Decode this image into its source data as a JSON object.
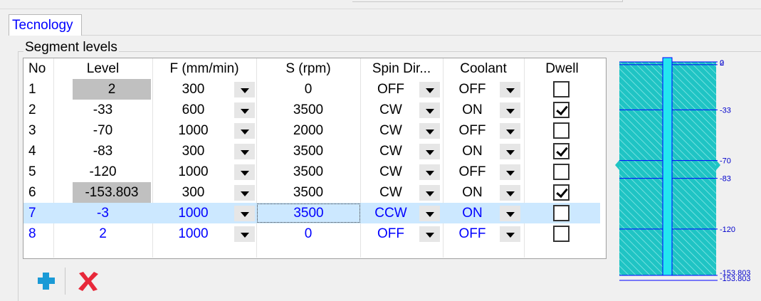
{
  "tab": {
    "label": "Tecnology"
  },
  "group": {
    "title": "Segment levels"
  },
  "columns": [
    "No",
    "Level",
    "F (mm/min)",
    "S (rpm)",
    "Spin Dir...",
    "Coolant",
    "Dwell"
  ],
  "rows": [
    {
      "no": "1",
      "level": "2",
      "feed": "300",
      "speed": "0",
      "spin": "OFF",
      "coolant": "OFF",
      "dwell": false,
      "level_gray": true,
      "blue": false,
      "selected": false
    },
    {
      "no": "2",
      "level": "-33",
      "feed": "600",
      "speed": "3500",
      "spin": "CW",
      "coolant": "ON",
      "dwell": true,
      "level_gray": false,
      "blue": false,
      "selected": false
    },
    {
      "no": "3",
      "level": "-70",
      "feed": "1000",
      "speed": "2000",
      "spin": "CW",
      "coolant": "OFF",
      "dwell": false,
      "level_gray": false,
      "blue": false,
      "selected": false
    },
    {
      "no": "4",
      "level": "-83",
      "feed": "300",
      "speed": "3500",
      "spin": "CW",
      "coolant": "ON",
      "dwell": true,
      "level_gray": false,
      "blue": false,
      "selected": false
    },
    {
      "no": "5",
      "level": "-120",
      "feed": "1000",
      "speed": "3500",
      "spin": "CW",
      "coolant": "OFF",
      "dwell": false,
      "level_gray": false,
      "blue": false,
      "selected": false
    },
    {
      "no": "6",
      "level": "-153.803",
      "feed": "300",
      "speed": "3500",
      "spin": "CW",
      "coolant": "ON",
      "dwell": true,
      "level_gray": true,
      "blue": false,
      "selected": false
    },
    {
      "no": "7",
      "level": "-3",
      "feed": "1000",
      "speed": "3500",
      "spin": "CCW",
      "coolant": "ON",
      "dwell": false,
      "level_gray": false,
      "blue": true,
      "selected": true
    },
    {
      "no": "8",
      "level": "2",
      "feed": "1000",
      "speed": "0",
      "spin": "OFF",
      "coolant": "OFF",
      "dwell": false,
      "level_gray": false,
      "blue": true,
      "selected": false
    }
  ],
  "toolbar": {
    "add_icon": "plus-icon",
    "delete_icon": "x-icon"
  },
  "preview": {
    "level_labels": [
      "0",
      "2",
      "-33",
      "-70",
      "-83",
      "-120",
      "-153.803",
      "-153.803"
    ],
    "colors": {
      "fill": "#1fc4c4",
      "line": "#0000ff",
      "rod": "#23e6f0",
      "label": "#0000cc"
    }
  },
  "colors": {
    "blue_text": "#0000ff",
    "selection": "#cce8ff",
    "gray_cell": "#c0c0c0"
  }
}
